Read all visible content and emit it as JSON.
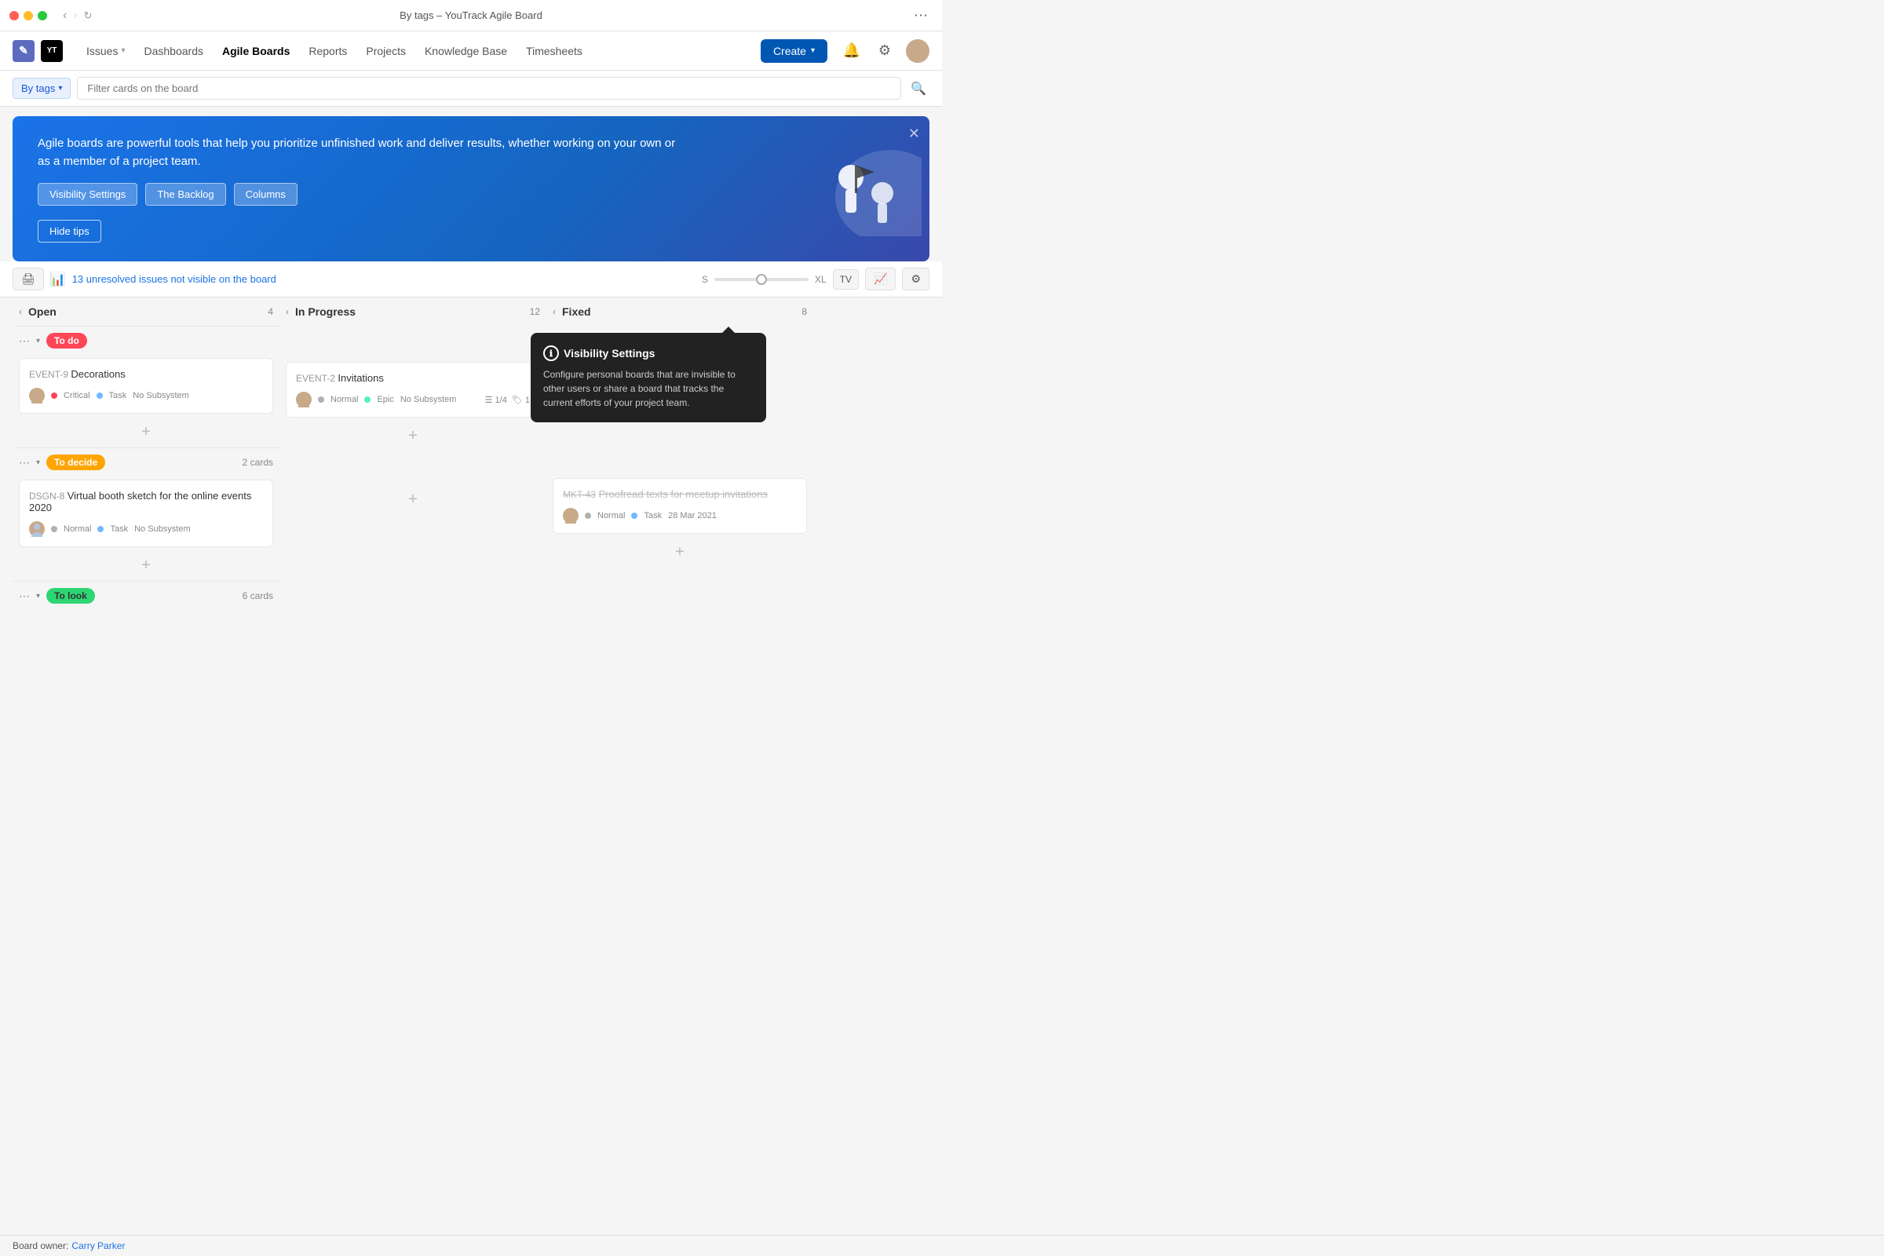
{
  "window": {
    "title": "By tags – YouTrack Agile Board",
    "more_icon": "⋯"
  },
  "navbar": {
    "logo_text": "YT",
    "app_icon": "✎",
    "items": [
      {
        "label": "Issues",
        "has_dropdown": true,
        "active": false
      },
      {
        "label": "Dashboards",
        "has_dropdown": false,
        "active": false
      },
      {
        "label": "Agile Boards",
        "has_dropdown": false,
        "active": true
      },
      {
        "label": "Reports",
        "has_dropdown": false,
        "active": false
      },
      {
        "label": "Projects",
        "has_dropdown": false,
        "active": false
      },
      {
        "label": "Knowledge Base",
        "has_dropdown": false,
        "active": false
      },
      {
        "label": "Timesheets",
        "has_dropdown": false,
        "active": false
      }
    ],
    "create_label": "Create",
    "bell_icon": "🔔",
    "settings_icon": "⚙",
    "avatar_emoji": "👤"
  },
  "filter_bar": {
    "by_tags_label": "By tags",
    "filter_placeholder": "Filter cards on the board",
    "search_icon": "🔍"
  },
  "banner": {
    "text": "Agile boards are powerful tools that help you prioritize unfinished work and deliver results, whether working on your own or as a member of a project team.",
    "btn1": "Visibility Settings",
    "btn2": "The Backlog",
    "btn3": "Columns",
    "hide_tips": "Hide tips"
  },
  "toolbar": {
    "printer_icon": "🖨",
    "chart_icon": "📊",
    "issues_text": "13 unresolved issues not visible on the board",
    "slider_min": "S",
    "slider_max": "XL",
    "tv_label": "TV",
    "graph_icon": "📈",
    "settings_icon": "⚙"
  },
  "columns": [
    {
      "title": "Open",
      "count": 4
    },
    {
      "title": "In Progress",
      "count": 12
    },
    {
      "title": "Fixed",
      "count": 8
    }
  ],
  "swimlanes": [
    {
      "tag": "To do",
      "tag_class": "tag-todo",
      "count": null,
      "cards": [
        {
          "col": 0,
          "id": "EVENT-9",
          "title": "Decorations",
          "priority": "Critical",
          "priority_class": "priority-critical",
          "type": "Task",
          "type_class": "type-task",
          "subsystem": "No Subsystem",
          "extras": null,
          "strikethrough": false
        },
        {
          "col": 1,
          "id": "EVENT-2",
          "title": "Invitations",
          "priority": "Normal",
          "priority_class": "priority-normal",
          "type": "Epic",
          "type_class": "type-epic",
          "subsystem": "No Subsystem",
          "checklist": "1/4",
          "tags": "1",
          "strikethrough": false
        }
      ]
    },
    {
      "tag": "To decide",
      "tag_class": "tag-decide",
      "count": "2 cards",
      "cards": [
        {
          "col": 0,
          "id": "DSGN-8",
          "title": "Virtual booth sketch for the online events 2020",
          "priority": "Normal",
          "priority_class": "priority-normal",
          "type": "Task",
          "type_class": "type-task",
          "subsystem": "No Subsystem",
          "extras": null,
          "strikethrough": false
        },
        {
          "col": 2,
          "id": "MKT-43",
          "title": "Proofread texts for meetup invitations",
          "priority": "Normal",
          "priority_class": "priority-normal",
          "type": "Task",
          "type_class": "type-task",
          "subsystem": null,
          "date": "28 Mar 2021",
          "strikethrough": true
        }
      ]
    },
    {
      "tag": "To look",
      "tag_class": "tag-look",
      "count": "6 cards",
      "cards": []
    }
  ],
  "tooltip": {
    "title": "Visibility Settings",
    "description": "Configure personal boards that are invisible to other users or share a board that tracks the current efforts of your project team.",
    "icon": "ℹ"
  },
  "status_bar": {
    "prefix": "Board owner:",
    "owner": "Carry Parker"
  }
}
